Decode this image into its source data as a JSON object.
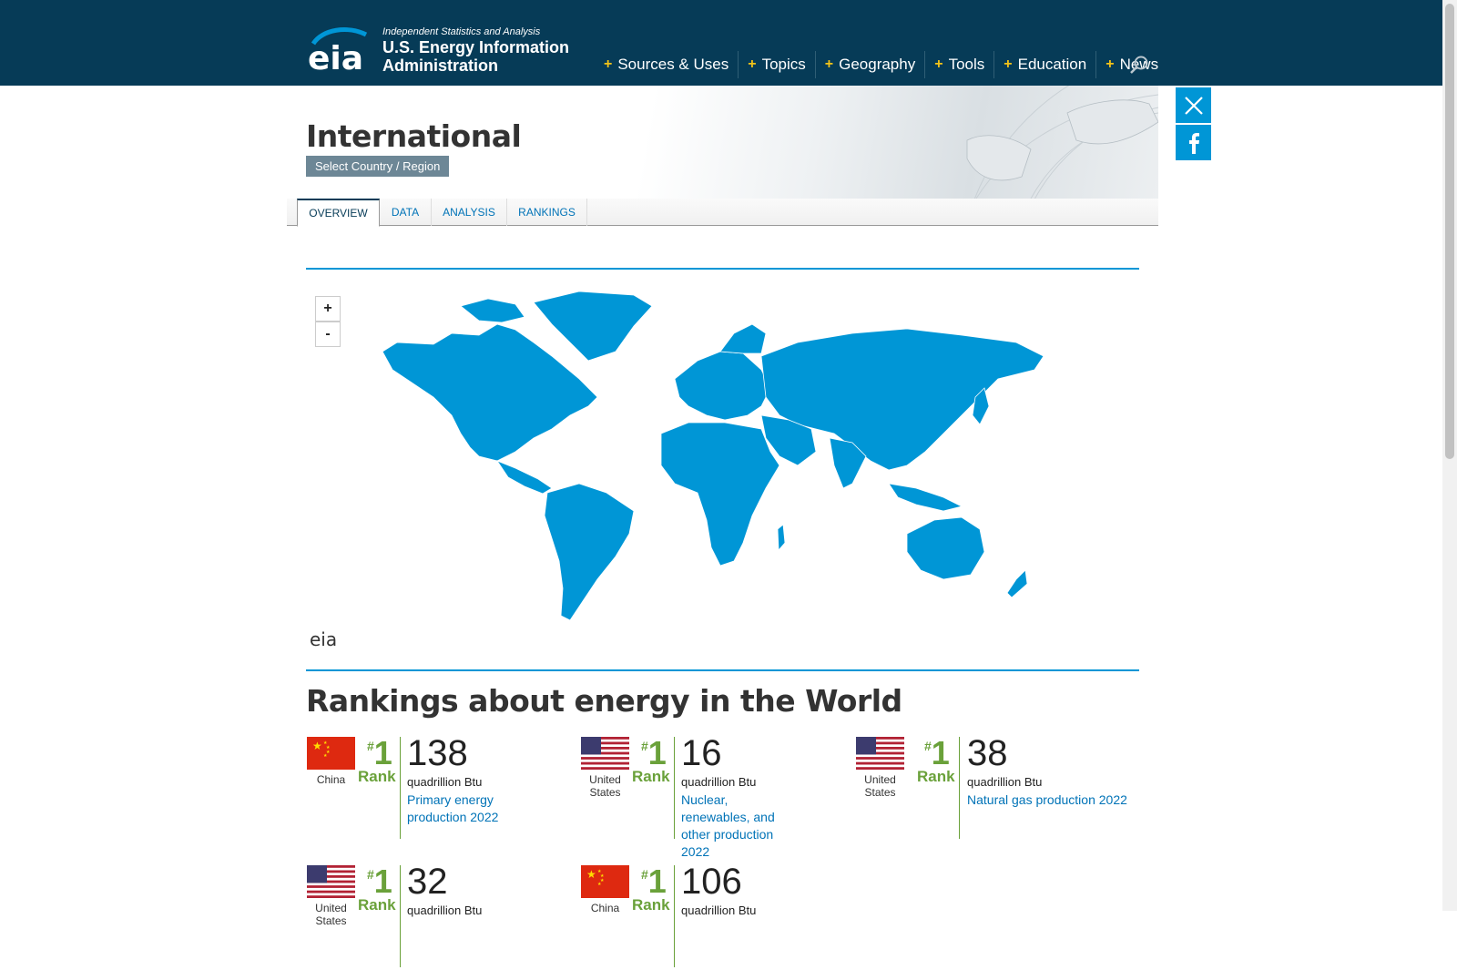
{
  "header": {
    "tagline": "Independent Statistics and Analysis",
    "org_name": "U.S. Energy Information Administration",
    "logo_text": "eia",
    "nav": [
      {
        "label": "Sources & Uses"
      },
      {
        "label": "Topics"
      },
      {
        "label": "Geography"
      },
      {
        "label": "Tools"
      },
      {
        "label": "Education"
      },
      {
        "label": "News"
      }
    ]
  },
  "page": {
    "title": "International",
    "select_label": "Select Country / Region"
  },
  "tabs": [
    {
      "label": "OVERVIEW",
      "active": true
    },
    {
      "label": "DATA",
      "active": false
    },
    {
      "label": "ANALYSIS",
      "active": false
    },
    {
      "label": "RANKINGS",
      "active": false
    }
  ],
  "map": {
    "zoom_in": "+",
    "zoom_out": "-",
    "watermark": "eia",
    "land_color": "#0096d6"
  },
  "rankings": {
    "title": "Rankings about energy in the World",
    "rank_label": "Rank",
    "cards": [
      {
        "country": "China",
        "flag": "china",
        "rank": "1",
        "value": "138",
        "unit": "quadrillion Btu",
        "desc": "Primary energy production 2022"
      },
      {
        "country": "United States",
        "flag": "usa",
        "rank": "1",
        "value": "16",
        "unit": "quadrillion Btu",
        "desc": "Nuclear, renewables, and other production 2022"
      },
      {
        "country": "United States",
        "flag": "usa",
        "rank": "1",
        "value": "38",
        "unit": "quadrillion Btu",
        "desc": "Natural gas production 2022"
      },
      {
        "country": "United States",
        "flag": "usa",
        "rank": "1",
        "value": "32",
        "unit": "quadrillion Btu",
        "desc": ""
      },
      {
        "country": "China",
        "flag": "china",
        "rank": "1",
        "value": "106",
        "unit": "quadrillion Btu",
        "desc": ""
      }
    ]
  },
  "colors": {
    "header_bg": "#063b57",
    "accent": "#0096d6",
    "rank_green": "#6aa13a",
    "nav_plus": "#f2c318"
  }
}
